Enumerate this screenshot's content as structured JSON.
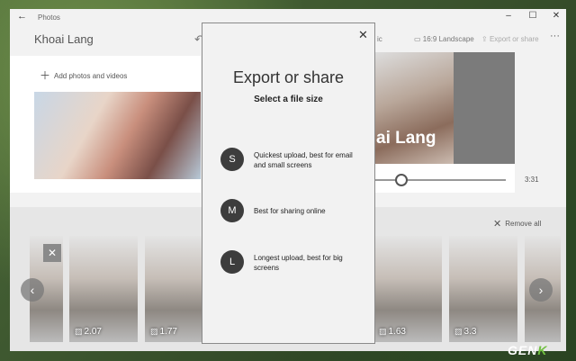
{
  "window": {
    "app_name": "Photos",
    "back_icon": "back-arrow-icon",
    "controls": {
      "minimize": "–",
      "maximize": "☐",
      "close": "✕"
    }
  },
  "editor": {
    "project_title": "Khoai Lang",
    "undo_icon": "undo-icon",
    "music_label": "ic",
    "aspect_label": "16:9 Landscape",
    "export_label": "Export or share",
    "more_label": "···"
  },
  "library": {
    "add_label": "Add photos and videos"
  },
  "preview": {
    "overlay_text": "ai Lang",
    "time": "3:31",
    "playhead_fraction": 0.2
  },
  "storyboard": {
    "remove_all_label": "Remove all",
    "cards": [
      {
        "duration": ""
      },
      {
        "duration": "2.07"
      },
      {
        "duration": "1.77"
      },
      {
        "duration": "1.63"
      },
      {
        "duration": "3.3"
      },
      {
        "duration": ""
      }
    ]
  },
  "dialog": {
    "title": "Export or share",
    "subtitle": "Select a file size",
    "options": [
      {
        "letter": "S",
        "text": "Quickest upload, best for email and small screens"
      },
      {
        "letter": "M",
        "text": "Best for sharing online"
      },
      {
        "letter": "L",
        "text": "Longest upload, best for big screens"
      }
    ]
  },
  "watermark": {
    "main": "GEN",
    "accent": "K"
  }
}
